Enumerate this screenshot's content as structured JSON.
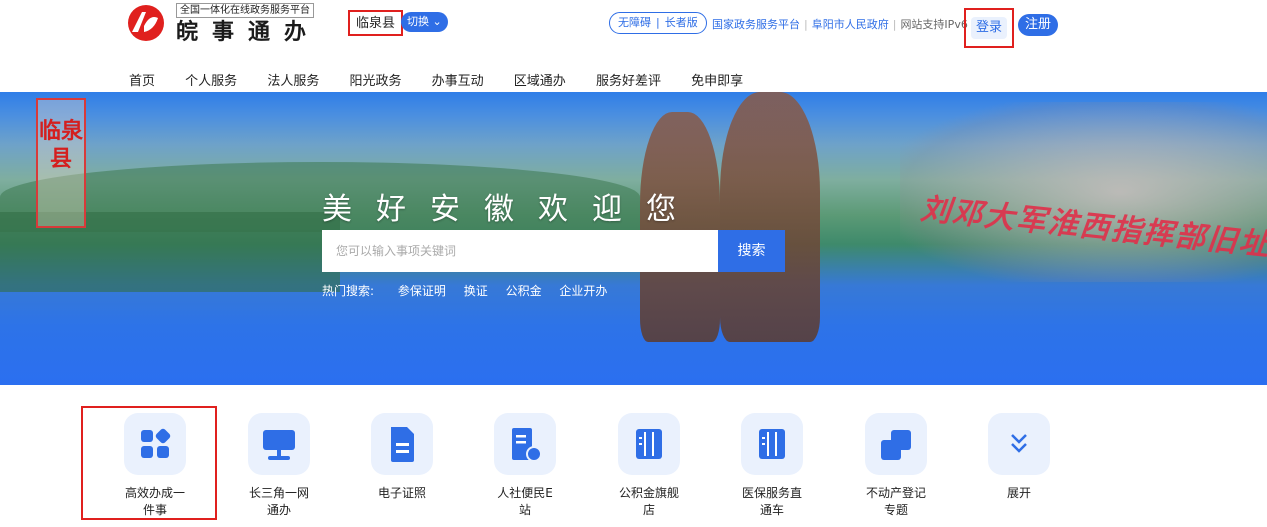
{
  "header": {
    "platform_sub": "全国一体化在线政务服务平台",
    "brand": "皖事通办",
    "region": "临泉县",
    "switch_label": "切换",
    "accessibility": "无障碍",
    "elder_mode": "长者版",
    "links": [
      "国家政务服务平台",
      "阜阳市人民政府"
    ],
    "ipv6": "网站支持IPv6",
    "login": "登录",
    "register": "注册"
  },
  "nav": [
    "首页",
    "个人服务",
    "法人服务",
    "阳光政务",
    "办事互动",
    "区域通办",
    "服务好差评",
    "免申即享"
  ],
  "banner": {
    "stamp": "临泉县",
    "welcome": "美好安徽欢迎您",
    "calligraphy": "刘邓大军淮西指挥部旧址",
    "search": {
      "placeholder": "您可以输入事项关键词",
      "button": "搜索"
    },
    "hot_label": "热门搜索:",
    "hot": [
      "参保证明",
      "换证",
      "公积金",
      "企业开办"
    ]
  },
  "services": [
    {
      "label": "高效办成一件事",
      "icon": "grid-icon"
    },
    {
      "label": "长三角一网通办",
      "icon": "monitor-icon"
    },
    {
      "label": "电子证照",
      "icon": "document-icon"
    },
    {
      "label": "人社便民E站",
      "icon": "id-card-icon"
    },
    {
      "label": "公积金旗舰店",
      "icon": "columns-icon"
    },
    {
      "label": "医保服务直通车",
      "icon": "columns-icon"
    },
    {
      "label": "不动产登记专题",
      "icon": "overlap-squares-icon"
    },
    {
      "label": "展开",
      "icon": "chevron-double-down-icon"
    }
  ],
  "colors": {
    "primary": "#2f6ee6",
    "highlight": "#e0201e",
    "icon_bg": "#eaf1fd"
  }
}
